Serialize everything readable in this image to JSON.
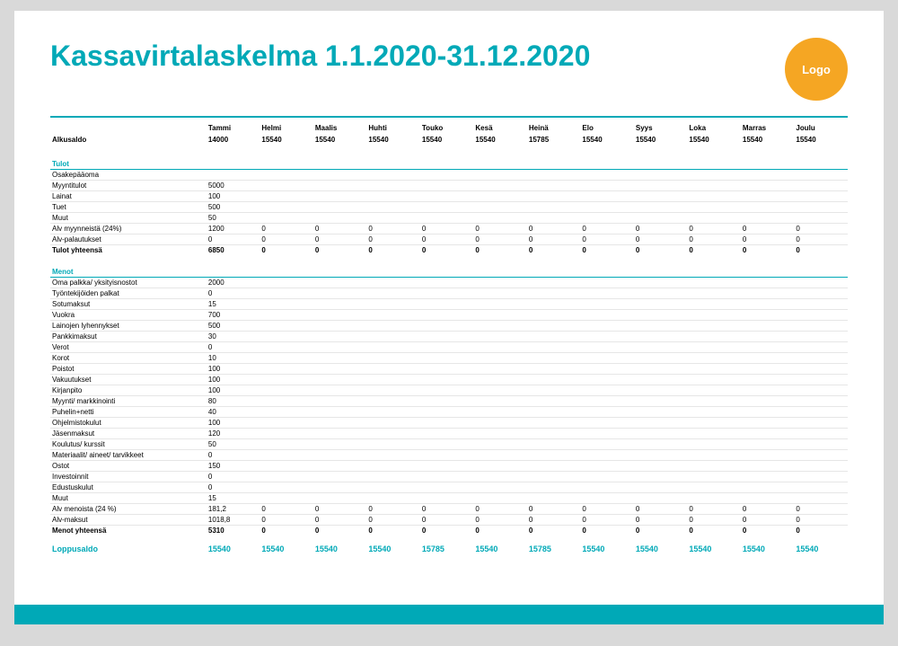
{
  "title": "Kassavirtalaskelma 1.1.2020-31.12.2020",
  "logo_text": "Logo",
  "months": [
    "Tammi",
    "Helmi",
    "Maalis",
    "Huhti",
    "Touko",
    "Kesä",
    "Heinä",
    "Elo",
    "Syys",
    "Loka",
    "Marras",
    "Joulu"
  ],
  "alkusaldo": {
    "label": "Alkusaldo",
    "values": [
      "14000",
      "15540",
      "15540",
      "15540",
      "15540",
      "15540",
      "15785",
      "15540",
      "15540",
      "15540",
      "15540",
      "15540"
    ]
  },
  "tulot": {
    "heading": "Tulot",
    "rows": [
      {
        "label": "Osakepääoma",
        "values": [
          "",
          "",
          "",
          "",
          "",
          "",
          "",
          "",
          "",
          "",
          "",
          ""
        ]
      },
      {
        "label": "Myyntitulot",
        "values": [
          "5000",
          "",
          "",
          "",
          "",
          "",
          "",
          "",
          "",
          "",
          "",
          ""
        ]
      },
      {
        "label": "Lainat",
        "values": [
          "100",
          "",
          "",
          "",
          "",
          "",
          "",
          "",
          "",
          "",
          "",
          ""
        ]
      },
      {
        "label": "Tuet",
        "values": [
          "500",
          "",
          "",
          "",
          "",
          "",
          "",
          "",
          "",
          "",
          "",
          ""
        ]
      },
      {
        "label": "Muut",
        "values": [
          "50",
          "",
          "",
          "",
          "",
          "",
          "",
          "",
          "",
          "",
          "",
          ""
        ]
      },
      {
        "label": "Alv myynneistä (24%)",
        "values": [
          "1200",
          "0",
          "0",
          "0",
          "0",
          "0",
          "0",
          "0",
          "0",
          "0",
          "0",
          "0"
        ]
      },
      {
        "label": "Alv-palautukset",
        "values": [
          "0",
          "0",
          "0",
          "0",
          "0",
          "0",
          "0",
          "0",
          "0",
          "0",
          "0",
          "0"
        ]
      }
    ],
    "total": {
      "label": "Tulot yhteensä",
      "values": [
        "6850",
        "0",
        "0",
        "0",
        "0",
        "0",
        "0",
        "0",
        "0",
        "0",
        "0",
        "0"
      ]
    }
  },
  "menot": {
    "heading": "Menot",
    "rows": [
      {
        "label": "Oma palkka/ yksityisnostot",
        "values": [
          "2000",
          "",
          "",
          "",
          "",
          "",
          "",
          "",
          "",
          "",
          "",
          ""
        ]
      },
      {
        "label": "Työntekijöiden palkat",
        "values": [
          "0",
          "",
          "",
          "",
          "",
          "",
          "",
          "",
          "",
          "",
          "",
          ""
        ]
      },
      {
        "label": "Sotumaksut",
        "values": [
          "15",
          "",
          "",
          "",
          "",
          "",
          "",
          "",
          "",
          "",
          "",
          ""
        ]
      },
      {
        "label": "Vuokra",
        "values": [
          "700",
          "",
          "",
          "",
          "",
          "",
          "",
          "",
          "",
          "",
          "",
          ""
        ]
      },
      {
        "label": "Lainojen lyhennykset",
        "values": [
          "500",
          "",
          "",
          "",
          "",
          "",
          "",
          "",
          "",
          "",
          "",
          ""
        ]
      },
      {
        "label": "Pankkimaksut",
        "values": [
          "30",
          "",
          "",
          "",
          "",
          "",
          "",
          "",
          "",
          "",
          "",
          ""
        ]
      },
      {
        "label": "Verot",
        "values": [
          "0",
          "",
          "",
          "",
          "",
          "",
          "",
          "",
          "",
          "",
          "",
          ""
        ]
      },
      {
        "label": "Korot",
        "values": [
          "10",
          "",
          "",
          "",
          "",
          "",
          "",
          "",
          "",
          "",
          "",
          ""
        ]
      },
      {
        "label": "Poistot",
        "values": [
          "100",
          "",
          "",
          "",
          "",
          "",
          "",
          "",
          "",
          "",
          "",
          ""
        ]
      },
      {
        "label": "Vakuutukset",
        "values": [
          "100",
          "",
          "",
          "",
          "",
          "",
          "",
          "",
          "",
          "",
          "",
          ""
        ]
      },
      {
        "label": "Kirjanpito",
        "values": [
          "100",
          "",
          "",
          "",
          "",
          "",
          "",
          "",
          "",
          "",
          "",
          ""
        ]
      },
      {
        "label": "Myynti/ markkinointi",
        "values": [
          "80",
          "",
          "",
          "",
          "",
          "",
          "",
          "",
          "",
          "",
          "",
          ""
        ]
      },
      {
        "label": "Puhelin+netti",
        "values": [
          "40",
          "",
          "",
          "",
          "",
          "",
          "",
          "",
          "",
          "",
          "",
          ""
        ]
      },
      {
        "label": "Ohjelmistokulut",
        "values": [
          "100",
          "",
          "",
          "",
          "",
          "",
          "",
          "",
          "",
          "",
          "",
          ""
        ]
      },
      {
        "label": "Jäsenmaksut",
        "values": [
          "120",
          "",
          "",
          "",
          "",
          "",
          "",
          "",
          "",
          "",
          "",
          ""
        ]
      },
      {
        "label": "Koulutus/ kurssit",
        "values": [
          "50",
          "",
          "",
          "",
          "",
          "",
          "",
          "",
          "",
          "",
          "",
          ""
        ]
      },
      {
        "label": "Materiaalit/ aineet/ tarvikkeet",
        "values": [
          "0",
          "",
          "",
          "",
          "",
          "",
          "",
          "",
          "",
          "",
          "",
          ""
        ]
      },
      {
        "label": "Ostot",
        "values": [
          "150",
          "",
          "",
          "",
          "",
          "",
          "",
          "",
          "",
          "",
          "",
          ""
        ]
      },
      {
        "label": "Investoinnit",
        "values": [
          "0",
          "",
          "",
          "",
          "",
          "",
          "",
          "",
          "",
          "",
          "",
          ""
        ]
      },
      {
        "label": "Edustuskulut",
        "values": [
          "0",
          "",
          "",
          "",
          "",
          "",
          "",
          "",
          "",
          "",
          "",
          ""
        ]
      },
      {
        "label": "Muut",
        "values": [
          "15",
          "",
          "",
          "",
          "",
          "",
          "",
          "",
          "",
          "",
          "",
          ""
        ]
      },
      {
        "label": "Alv menoista (24 %)",
        "values": [
          "181,2",
          "0",
          "0",
          "0",
          "0",
          "0",
          "0",
          "0",
          "0",
          "0",
          "0",
          "0"
        ]
      },
      {
        "label": "Alv-maksut",
        "values": [
          "1018,8",
          "0",
          "0",
          "0",
          "0",
          "0",
          "0",
          "0",
          "0",
          "0",
          "0",
          "0"
        ]
      }
    ],
    "total": {
      "label": "Menot yhteensä",
      "values": [
        "5310",
        "0",
        "0",
        "0",
        "0",
        "0",
        "0",
        "0",
        "0",
        "0",
        "0",
        "0"
      ]
    }
  },
  "loppusaldo": {
    "label": "Loppusaldo",
    "values": [
      "15540",
      "15540",
      "15540",
      "15540",
      "15785",
      "15540",
      "15785",
      "15540",
      "15540",
      "15540",
      "15540",
      "15540"
    ]
  }
}
